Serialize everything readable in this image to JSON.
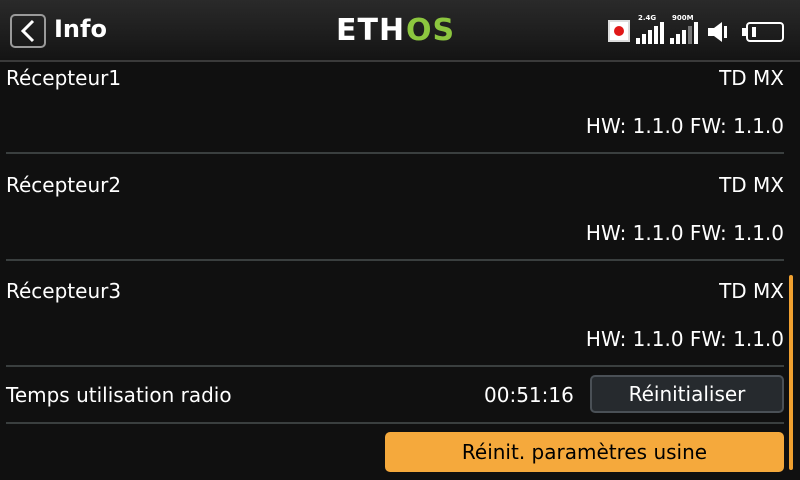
{
  "header": {
    "title": "Info",
    "logo_text": "ETHOS",
    "signal_24": "2.4G",
    "signal_900": "900M",
    "icons": [
      "back-icon",
      "record-icon",
      "signal-icon",
      "signal-icon",
      "speaker-icon",
      "battery-icon"
    ]
  },
  "receivers": [
    {
      "name": "Récepteur1",
      "model": "TD MX",
      "versions": "HW: 1.1.0 FW: 1.1.0"
    },
    {
      "name": "Récepteur2",
      "model": "TD MX",
      "versions": "HW: 1.1.0 FW: 1.1.0"
    },
    {
      "name": "Récepteur3",
      "model": "TD MX",
      "versions": "HW: 1.1.0 FW: 1.1.0"
    }
  ],
  "uptime": {
    "label": "Temps utilisation radio",
    "value": "00:51:16",
    "reset_label": "Réinitialiser"
  },
  "factory_reset_label": "Réinit. paramètres usine",
  "colors": {
    "accent": "#f5a93c",
    "logo_green": "#8cc63f",
    "background": "#101010"
  }
}
